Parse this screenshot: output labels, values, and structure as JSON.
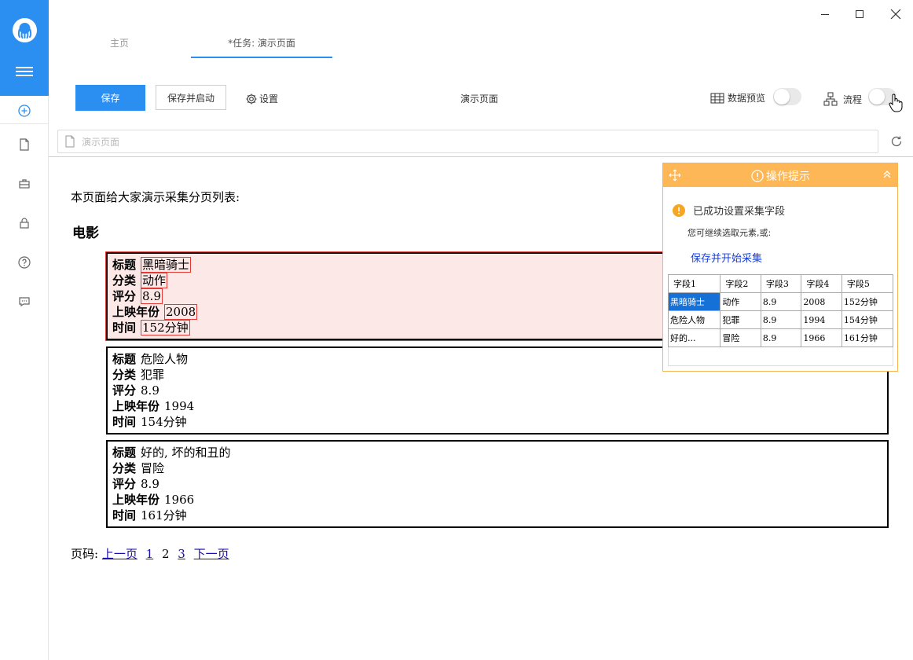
{
  "colors": {
    "accent": "#2b8ff2",
    "tips_header": "#fdb756",
    "highlight": "#e53935",
    "link": "#1a3fd8"
  },
  "sidebar": {
    "icons": [
      "logo-octopus",
      "menu-icon",
      "add-circle-icon",
      "file-icon",
      "briefcase-icon",
      "lock-icon",
      "help-icon",
      "message-icon"
    ]
  },
  "tabs": [
    {
      "label": "主页"
    },
    {
      "label": "*任务: 演示页面"
    }
  ],
  "toolbar": {
    "save_label": "保存",
    "save_start_label": "保存并启动",
    "settings_label": "设置",
    "page_name": "演示页面",
    "preview_label": "数据预览",
    "flow_label": "流程"
  },
  "urlbar": {
    "value": "演示页面"
  },
  "page": {
    "intro": "本页面给大家演示采集分页列表:",
    "heading": "电影",
    "field_labels": {
      "title": "标题",
      "category": "分类",
      "rating": "评分",
      "year": "上映年份",
      "duration": "时间"
    },
    "movies": [
      {
        "title": "黑暗骑士",
        "category": "动作",
        "rating": "8.9",
        "year": "2008",
        "duration": "152分钟"
      },
      {
        "title": "危险人物",
        "category": "犯罪",
        "rating": "8.9",
        "year": "1994",
        "duration": "154分钟"
      },
      {
        "title": "好的, 坏的和丑的",
        "category": "冒险",
        "rating": "8.9",
        "year": "1966",
        "duration": "161分钟"
      }
    ],
    "pager": {
      "label": "页码:",
      "prev": "上一页",
      "pages": [
        "1",
        "2",
        "3"
      ],
      "next": "下一页"
    }
  },
  "tips": {
    "title": "操作提示",
    "message": "已成功设置采集字段",
    "sub": "您可继续选取元素,或:",
    "link": "保存并开始采集",
    "columns": [
      "字段1",
      "字段2",
      "字段3",
      "字段4",
      "字段5"
    ],
    "rows": [
      [
        "黑暗骑士",
        "动作",
        "8.9",
        "2008",
        "152分钟"
      ],
      [
        "危险人物",
        "犯罪",
        "8.9",
        "1994",
        "154分钟"
      ],
      [
        "好的...",
        "冒险",
        "8.9",
        "1966",
        "161分钟"
      ]
    ]
  }
}
